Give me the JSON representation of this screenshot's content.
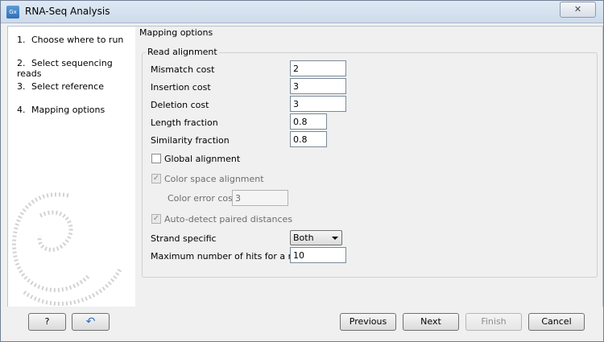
{
  "window": {
    "title": "RNA-Seq Analysis",
    "icon": "Gx",
    "close_label": "✕"
  },
  "steps": [
    {
      "num": "1.",
      "label": "Choose where to run"
    },
    {
      "num": "2.",
      "label": "Select sequencing reads"
    },
    {
      "num": "3.",
      "label": "Select reference"
    },
    {
      "num": "4.",
      "label": "Mapping options"
    }
  ],
  "panel": {
    "title": "Mapping options",
    "group_title": "Read alignment",
    "mismatch_cost": {
      "label": "Mismatch cost",
      "value": "2"
    },
    "insertion_cost": {
      "label": "Insertion cost",
      "value": "3"
    },
    "deletion_cost": {
      "label": "Deletion cost",
      "value": "3"
    },
    "length_fraction": {
      "label": "Length fraction",
      "value": "0.8"
    },
    "similarity_fraction": {
      "label": "Similarity fraction",
      "value": "0.8"
    },
    "global_alignment": {
      "label": "Global alignment",
      "checked": false
    },
    "color_space": {
      "label": "Color space alignment",
      "checked": true,
      "enabled": false
    },
    "color_error_cost": {
      "label": "Color error cost",
      "value": "3"
    },
    "auto_detect": {
      "label": "Auto-detect paired distances",
      "checked": true,
      "enabled": false
    },
    "strand_specific": {
      "label": "Strand specific",
      "value": "Both"
    },
    "max_hits": {
      "label": "Maximum number of hits for a read",
      "value": "10"
    }
  },
  "buttons": {
    "help": "?",
    "reset": "↶",
    "previous": "Previous",
    "next": "Next",
    "finish": "Finish",
    "cancel": "Cancel"
  },
  "colors": {
    "titlebar": "#d6e2f0",
    "accent": "#2e6fb5"
  }
}
